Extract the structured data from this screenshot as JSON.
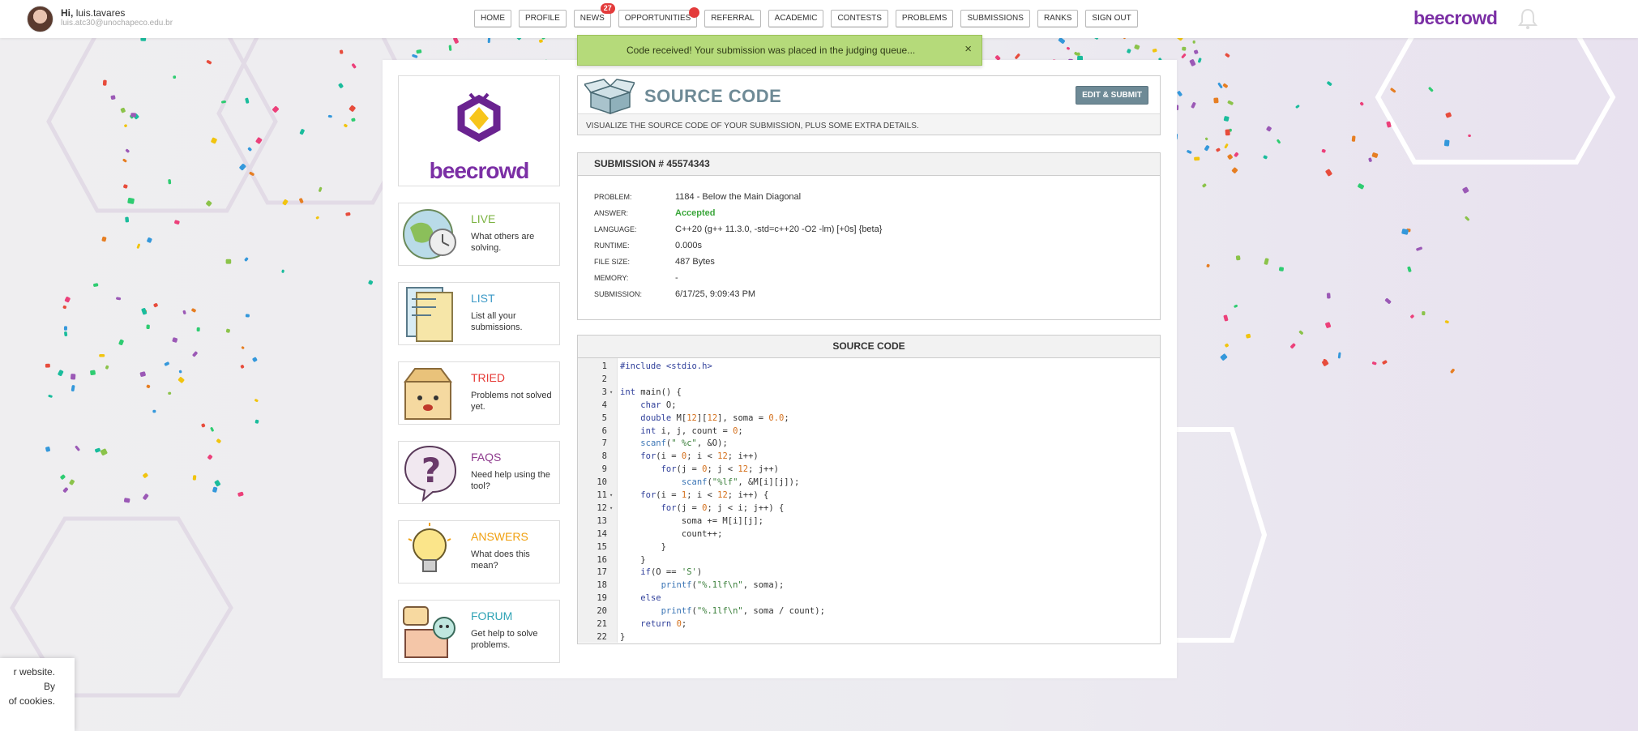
{
  "user": {
    "greeting_prefix": "Hi,",
    "name": "luis.tavares",
    "email": "luis.atc30@unochapeco.edu.br"
  },
  "nav": {
    "items": [
      {
        "label": "HOME"
      },
      {
        "label": "PROFILE"
      },
      {
        "label": "NEWS",
        "badge": "27"
      },
      {
        "label": "OPPORTUNITIES",
        "dot": true
      },
      {
        "label": "REFERRAL"
      },
      {
        "label": "ACADEMIC"
      },
      {
        "label": "CONTESTS"
      },
      {
        "label": "PROBLEMS"
      },
      {
        "label": "SUBMISSIONS"
      },
      {
        "label": "RANKS"
      },
      {
        "label": "SIGN OUT"
      }
    ]
  },
  "brand": "beecrowd",
  "toast": {
    "message": "Code received! Your submission was placed in the judging queue...",
    "close": "×"
  },
  "logo_text": "beecrowd",
  "sidebar": {
    "items": [
      {
        "title": "LIVE",
        "desc": "What others are solving.",
        "color": "#7cb342"
      },
      {
        "title": "LIST",
        "desc": "List all your submissions.",
        "color": "#3d9ac7"
      },
      {
        "title": "TRIED",
        "desc": "Problems not solved yet.",
        "color": "#e53935"
      },
      {
        "title": "FAQS",
        "desc": "Need help using the tool?",
        "color": "#8e3b8e"
      },
      {
        "title": "ANSWERS",
        "desc": "What does this mean?",
        "color": "#f0a010"
      },
      {
        "title": "FORUM",
        "desc": "Get help to solve problems.",
        "color": "#2fa3b5"
      }
    ]
  },
  "page": {
    "title": "SOURCE CODE",
    "edit_button": "EDIT & SUBMIT",
    "subtitle": "VISUALIZE THE SOURCE CODE OF YOUR SUBMISSION, PLUS SOME EXTRA DETAILS."
  },
  "submission": {
    "header": "SUBMISSION # 45574343",
    "details": [
      {
        "label": "PROBLEM:",
        "value": "1184 - Below the Main Diagonal"
      },
      {
        "label": "ANSWER:",
        "value": "Accepted"
      },
      {
        "label": "LANGUAGE:",
        "value": "C++20 (g++ 11.3.0, -std=c++20 -O2 -lm) [+0s] {beta}"
      },
      {
        "label": "RUNTIME:",
        "value": "0.000s"
      },
      {
        "label": "FILE SIZE:",
        "value": "487 Bytes"
      },
      {
        "label": "MEMORY:",
        "value": "-"
      },
      {
        "label": "SUBMISSION:",
        "value": "6/17/25, 9:09:43 PM"
      }
    ]
  },
  "source": {
    "header": "SOURCE CODE",
    "lines": [
      "#include <stdio.h>",
      "",
      "int main() {",
      "    char O;",
      "    double M[12][12], soma = 0.0;",
      "    int i, j, count = 0;",
      "    scanf(\" %c\", &O);",
      "    for(i = 0; i < 12; i++)",
      "        for(j = 0; j < 12; j++)",
      "            scanf(\"%lf\", &M[i][j]);",
      "    for(i = 1; i < 12; i++) {",
      "        for(j = 0; j < i; j++) {",
      "            soma += M[i][j];",
      "            count++;",
      "        }",
      "    }",
      "    if(O == 'S')",
      "        printf(\"%.1lf\\n\", soma);",
      "    else",
      "        printf(\"%.1lf\\n\", soma / count);",
      "    return 0;",
      "}"
    ],
    "folds": [
      3,
      11,
      12
    ]
  },
  "cookie": {
    "text_line1": "r website. By",
    "text_line2": "of cookies."
  }
}
